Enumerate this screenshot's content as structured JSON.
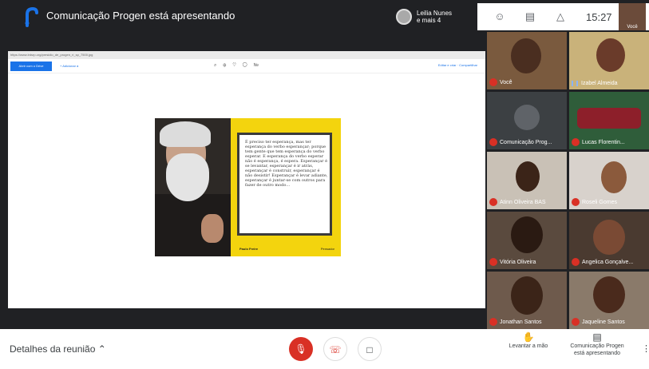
{
  "header": {
    "title": "Comunicação Progen está apresentando",
    "participants_chip": {
      "line1": "Leilia Nunes",
      "line2": "e mais 4"
    },
    "time": "15:27",
    "self_label": "Você"
  },
  "presentation": {
    "url": "https://www.lrdsrp.org/presidio_de_progen_ri_sp_7500.jpg",
    "toolbar": {
      "primary_label": "Abrir com o Drive",
      "add_label": "+ Adicionar à",
      "right_label": "Editar e criar · Compartilhar"
    },
    "slide": {
      "quote": "É preciso ter esperança, mas ter esperança do verbo esperançar; porque tem gente que tem esperança do verbo esperar. E esperança do verbo esperar não é esperança, é espera. Esperançar é se levantar, esperançar é ir atrás, esperançar é construir, esperançar é não desistir! Esperançar é levar adiante, esperançar é juntar-se com outros para fazer de outro modo…",
      "author": "Paulo Freire",
      "brand": "Pensador"
    }
  },
  "tiles": [
    {
      "name": "Você",
      "mic": "off"
    },
    {
      "name": "Izabel Almeida",
      "mic": "speaking"
    },
    {
      "name": "Comunicação Prog...",
      "mic": "off"
    },
    {
      "name": "Lucas Florentin...",
      "mic": "off"
    },
    {
      "name": "Atinn Oliveira BAS",
      "mic": "off"
    },
    {
      "name": "Roseli Gomes",
      "mic": "off"
    },
    {
      "name": "Vitória Oliveira",
      "mic": "off"
    },
    {
      "name": "Angelica Gonçalve...",
      "mic": "off"
    },
    {
      "name": "Jonathan Santos",
      "mic": "off"
    },
    {
      "name": "Jaqueline Santos",
      "mic": "off"
    }
  ],
  "bottom": {
    "details_label": "Detalhes da reunião",
    "raise_hand_label": "Levantar a mão",
    "presenting_line1": "Comunicação Progen",
    "presenting_line2": "está apresentando"
  },
  "colors": {
    "accent": "#1a73e8",
    "danger": "#d93025",
    "slide_yellow": "#f3d40e"
  }
}
